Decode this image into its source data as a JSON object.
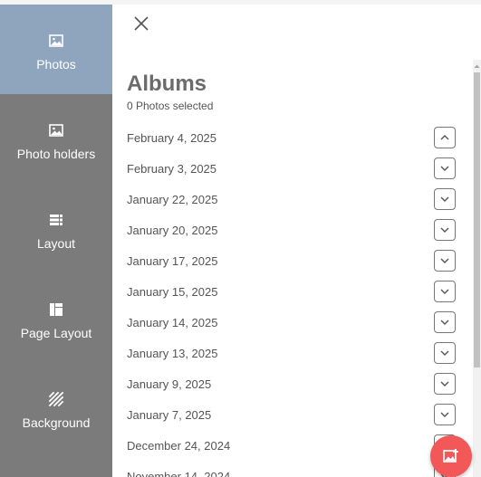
{
  "sidebar": {
    "items": [
      {
        "label": "Photos",
        "icon": "image-icon",
        "active": true
      },
      {
        "label": "Photo holders",
        "icon": "image-icon",
        "active": false
      },
      {
        "label": "Layout",
        "icon": "layout-rows-icon",
        "active": false
      },
      {
        "label": "Page Layout",
        "icon": "page-layout-icon",
        "active": false
      },
      {
        "label": "Background",
        "icon": "hatch-pattern-icon",
        "active": false
      }
    ]
  },
  "panel": {
    "close_icon": "close-icon",
    "title": "Albums",
    "subtitle": "0 Photos selected",
    "albums": [
      {
        "date": "February 4, 2025",
        "expanded": true
      },
      {
        "date": "February 3, 2025",
        "expanded": false
      },
      {
        "date": "January 22, 2025",
        "expanded": false
      },
      {
        "date": "January 20, 2025",
        "expanded": false
      },
      {
        "date": "January 17, 2025",
        "expanded": false
      },
      {
        "date": "January 15, 2025",
        "expanded": false
      },
      {
        "date": "January 14, 2025",
        "expanded": false
      },
      {
        "date": "January 13, 2025",
        "expanded": false
      },
      {
        "date": "January 9, 2025",
        "expanded": false
      },
      {
        "date": "January 7, 2025",
        "expanded": false
      },
      {
        "date": "December 24, 2024",
        "expanded": false
      },
      {
        "date": "November 14, 2024",
        "expanded": false
      }
    ]
  },
  "fab": {
    "icon": "add-photo-icon"
  },
  "colors": {
    "sidebar_bg": "#7b7b7b",
    "sidebar_active": "#8fa4bd",
    "fab": "#f25858"
  }
}
